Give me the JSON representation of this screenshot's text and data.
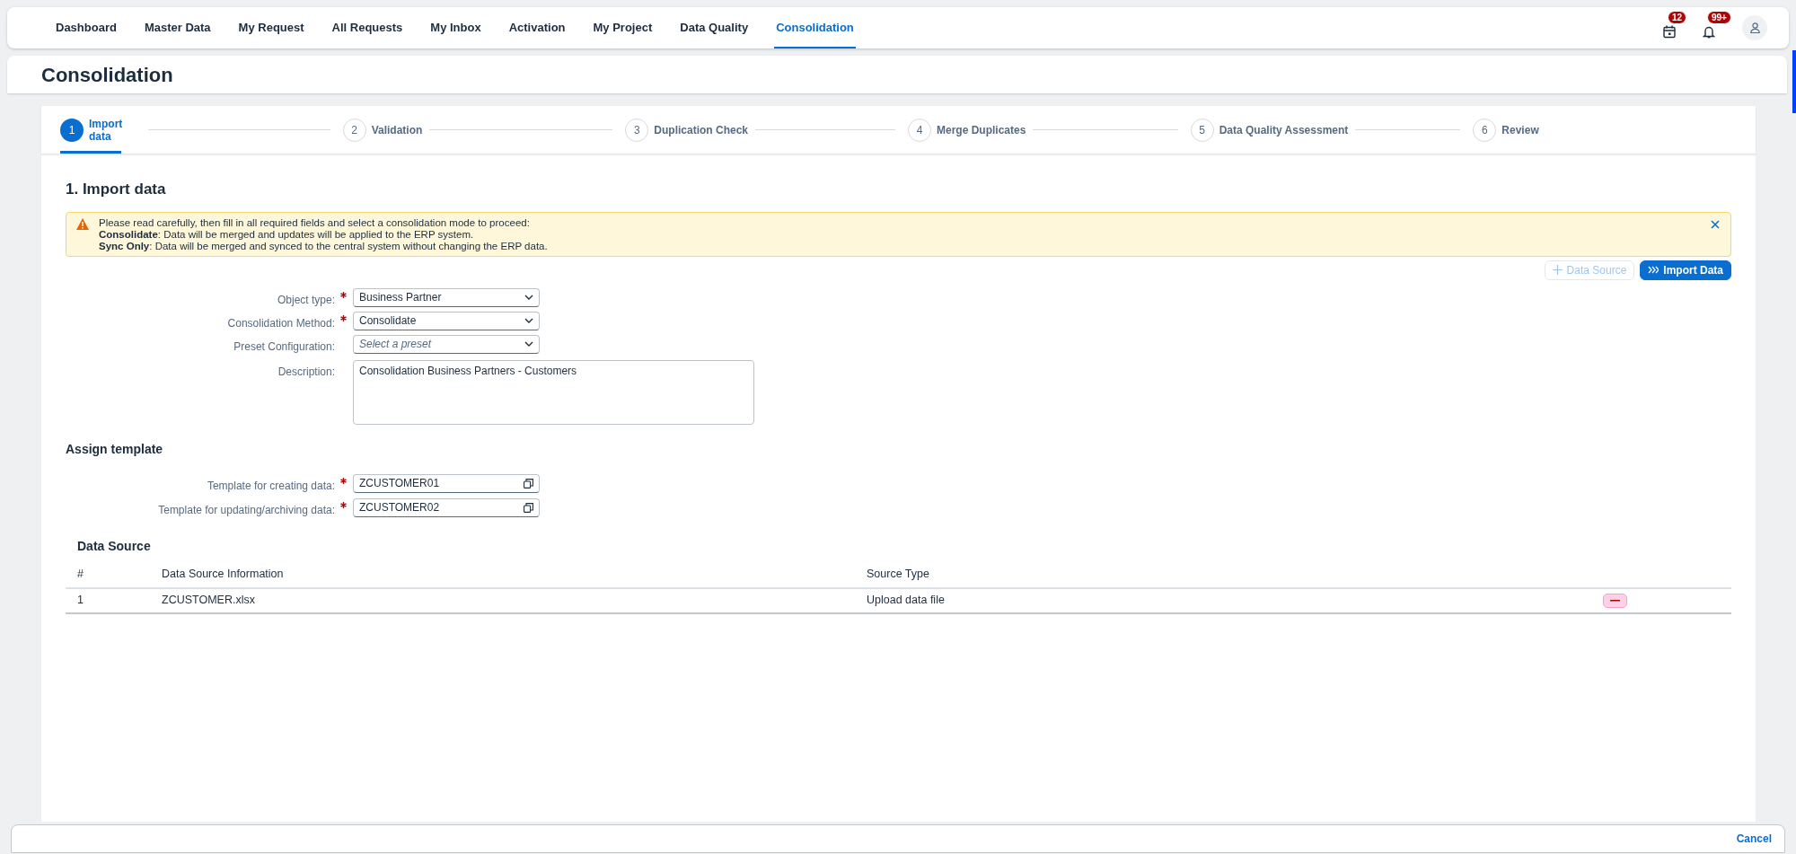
{
  "nav": {
    "tabs": [
      {
        "label": "Dashboard",
        "selected": false
      },
      {
        "label": "Master Data",
        "selected": false
      },
      {
        "label": "My Request",
        "selected": false
      },
      {
        "label": "All Requests",
        "selected": false
      },
      {
        "label": "My Inbox",
        "selected": false
      },
      {
        "label": "Activation",
        "selected": false
      },
      {
        "label": "My Project",
        "selected": false
      },
      {
        "label": "Data Quality",
        "selected": false
      },
      {
        "label": "Consolidation",
        "selected": true
      }
    ],
    "actions": [
      {
        "kind": "calendar",
        "badge": "12"
      },
      {
        "kind": "bell",
        "badge": "99+"
      },
      {
        "kind": "user"
      }
    ]
  },
  "page_title": "Consolidation",
  "stepper": {
    "steps": [
      {
        "number": "1",
        "label": "Import data",
        "selected": true
      },
      {
        "number": "2",
        "label": "Validation",
        "selected": false
      },
      {
        "number": "3",
        "label": "Duplication Check",
        "selected": false
      },
      {
        "number": "4",
        "label": "Merge Duplicates",
        "selected": false
      },
      {
        "number": "5",
        "label": "Data Quality Assessment",
        "selected": false
      },
      {
        "number": "6",
        "label": "Review",
        "selected": false
      }
    ]
  },
  "section_title": "1. Import data",
  "alert": {
    "lines": [
      "Please read carefully, then fill in all required fields and select a consolidation mode to proceed:",
      "**Consolidate**: Data will be merged and updates will be applied to the ERP system.",
      "**Sync Only**: Data will be merged and synced to the central system without changing the ERP data."
    ]
  },
  "toolbar": {
    "buttons": [
      {
        "label": "Data Source",
        "kind": "add",
        "disabled": true
      },
      {
        "label": "Import Data",
        "kind": "import",
        "disabled": false
      }
    ]
  },
  "form": {
    "fields": [
      {
        "label": "Object type:",
        "required": true,
        "kind": "select",
        "value": "Business Partner"
      },
      {
        "label": "Consolidation Method:",
        "required": true,
        "kind": "select",
        "value": "Consolidate"
      },
      {
        "label": "Preset Configuration:",
        "required": false,
        "kind": "select",
        "placeholder": "Select a preset"
      },
      {
        "label": "Description:",
        "required": false,
        "kind": "textarea",
        "value": "Consolidation Business Partners - Customers"
      }
    ]
  },
  "template": {
    "title": "Assign template",
    "fields": [
      {
        "label": "Template for creating data:",
        "required": true,
        "value": "ZCUSTOMER01"
      },
      {
        "label": "Template for updating/archiving data:",
        "required": true,
        "value": "ZCUSTOMER02"
      }
    ]
  },
  "data_source": {
    "title": "Data Source",
    "columns": [
      "#",
      "Data Source Information",
      "Source Type"
    ],
    "rows": [
      {
        "cells": [
          "1",
          "ZCUSTOMER.xlsx",
          "Upload data file"
        ]
      }
    ]
  },
  "footer": {
    "buttons": [
      "Cancel"
    ]
  }
}
